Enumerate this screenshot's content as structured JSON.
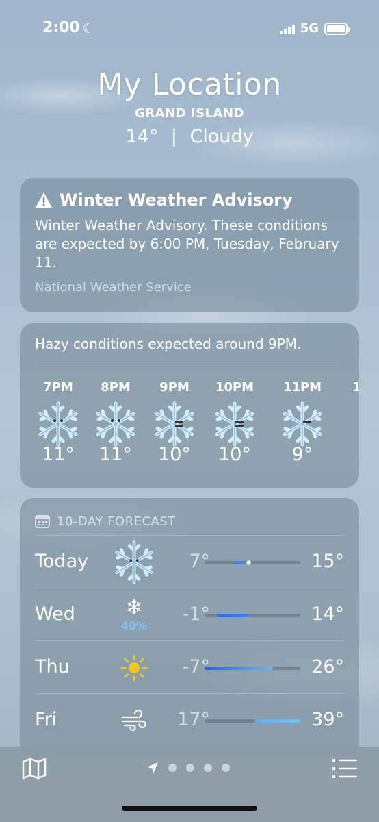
{
  "status_bar": {
    "time": "2:00",
    "network": "5G"
  },
  "header": {
    "title": "My Location",
    "subtitle": "GRAND ISLAND",
    "temp": "14°",
    "separator": "|",
    "condition": "Cloudy"
  },
  "advisory": {
    "title": "Winter Weather Advisory",
    "body": "Winter Weather Advisory. These conditions are expected by 6:00 PM, Tuesday, February 11.",
    "source": "National Weather Service"
  },
  "hourly": {
    "summary": "Hazy conditions expected around 9PM.",
    "hours": [
      {
        "label": "7PM",
        "temp": "11°",
        "icon": "snowflake-face-icon"
      },
      {
        "label": "8PM",
        "temp": "11°",
        "icon": "snowflake-face-icon"
      },
      {
        "label": "9PM",
        "temp": "10°",
        "icon": "snowflake-haze-icon"
      },
      {
        "label": "10PM",
        "temp": "10°",
        "icon": "snowflake-haze-icon"
      },
      {
        "label": "11PM",
        "temp": "9°",
        "icon": "snowflake-haze-icon"
      },
      {
        "label": "1",
        "temp": "",
        "icon": ""
      }
    ]
  },
  "forecast": {
    "header": "10-DAY FORECAST",
    "range": [
      -7,
      39
    ],
    "days": [
      {
        "name": "Today",
        "icon": "snowflake-face-icon",
        "precip": "",
        "low": "7°",
        "high": "15°",
        "low_val": 7,
        "high_val": 15,
        "current": 14,
        "color_from": "#3b7ff0",
        "color_to": "#4a8cf2"
      },
      {
        "name": "Wed",
        "icon": "snow-icon",
        "precip": "40%",
        "low": "-1°",
        "high": "14°",
        "low_val": -1,
        "high_val": 14,
        "color_from": "#2f6fe8",
        "color_to": "#3f7ff0"
      },
      {
        "name": "Thu",
        "icon": "sun-icon",
        "precip": "",
        "low": "-7°",
        "high": "26°",
        "low_val": -7,
        "high_val": 26,
        "color_from": "#2d5fe0",
        "color_to": "#6cb3f7"
      },
      {
        "name": "Fri",
        "icon": "wind-icon",
        "precip": "",
        "low": "17°",
        "high": "39°",
        "low_val": 17,
        "high_val": 39,
        "color_from": "#5aaef5",
        "color_to": "#72c2f6"
      }
    ]
  },
  "colors": {
    "card": "#7a8c9b",
    "precip": "#7dc3ff",
    "sun": "#f5c518"
  }
}
